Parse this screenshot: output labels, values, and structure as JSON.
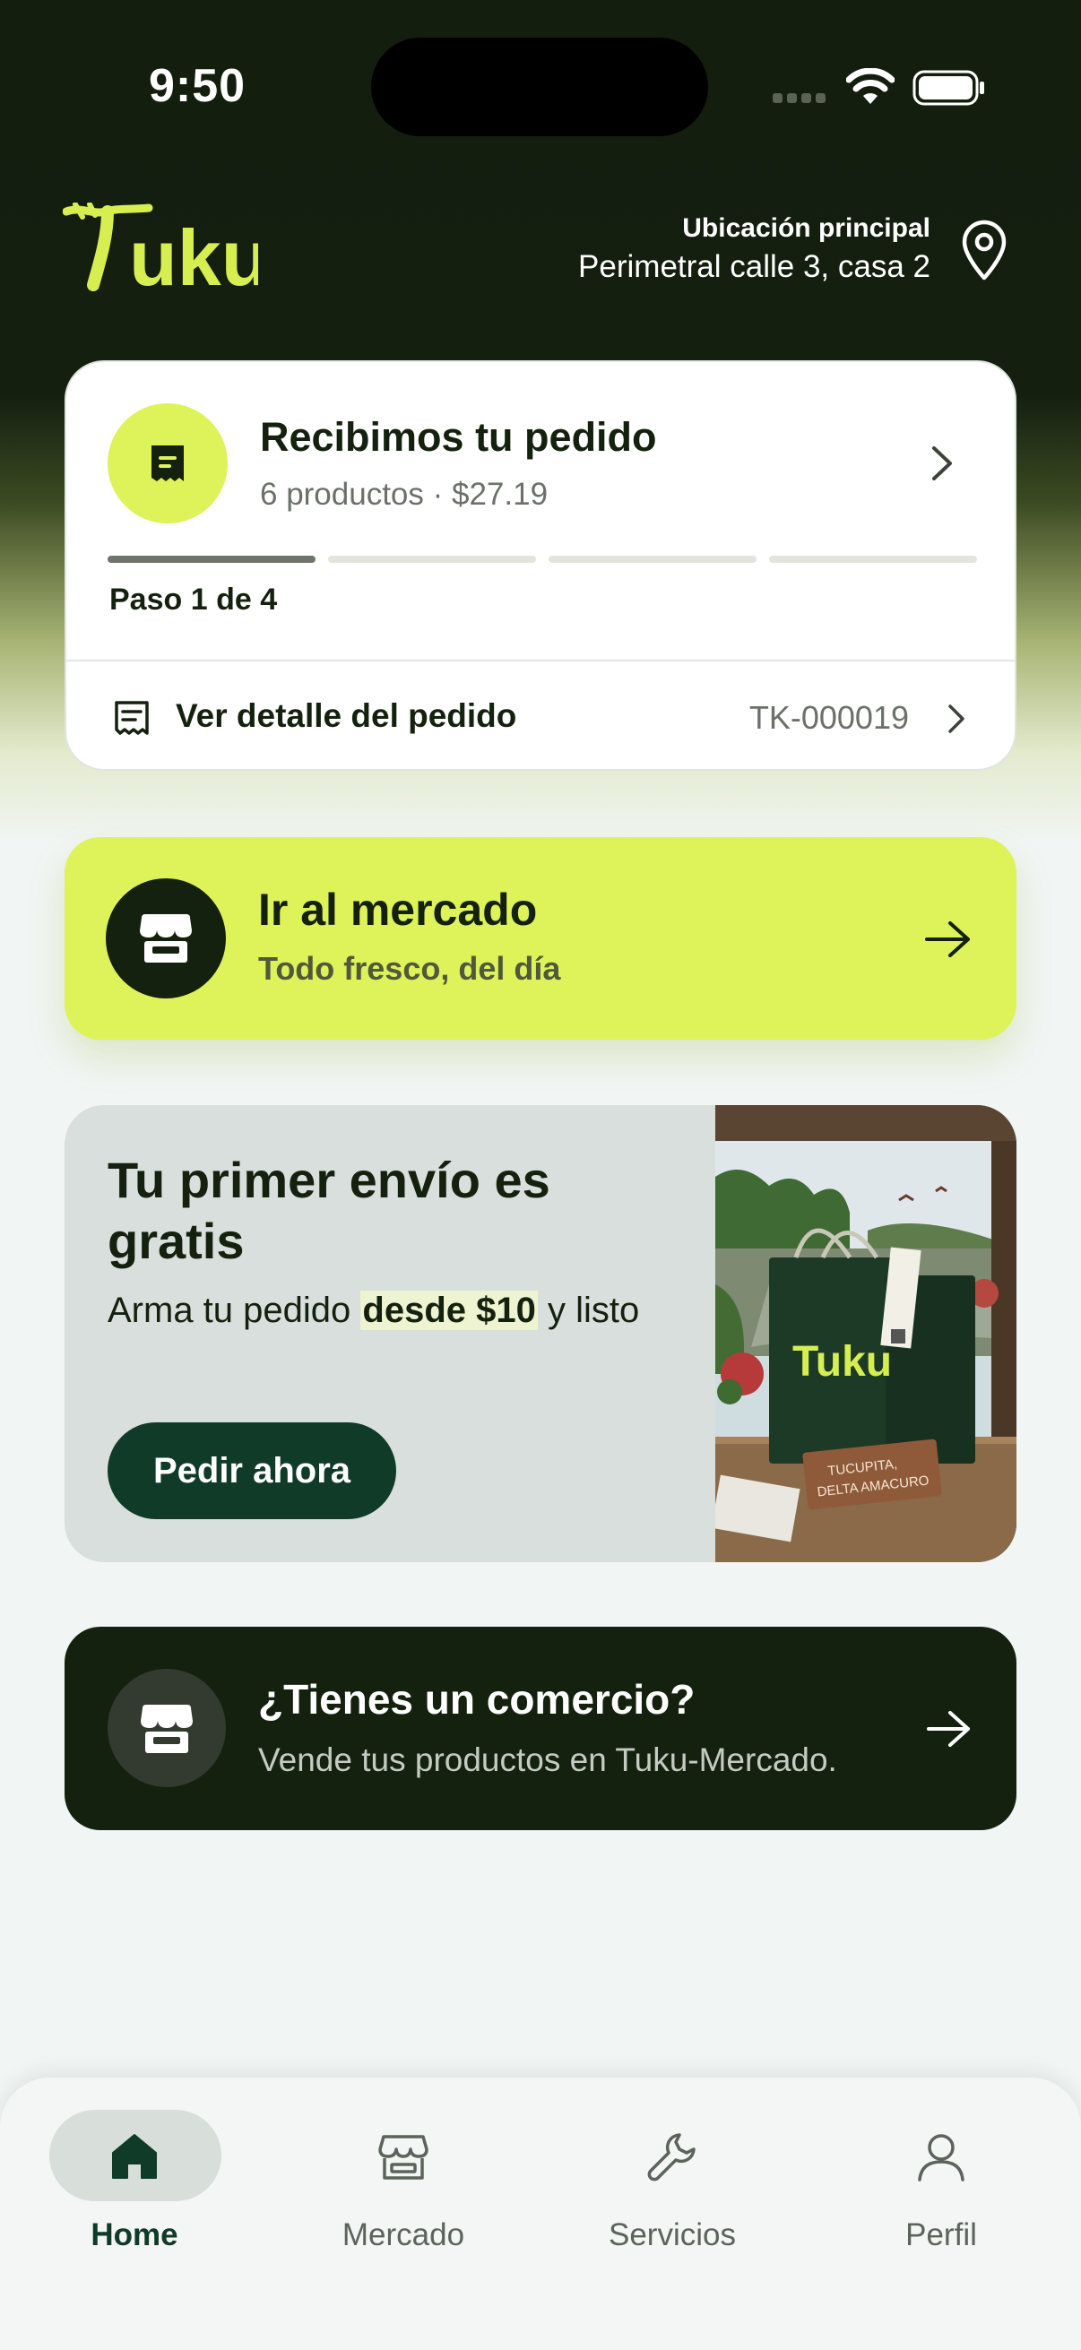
{
  "status_bar": {
    "time": "9:50",
    "icons": [
      "signal-icon",
      "wifi-icon",
      "battery-icon"
    ]
  },
  "header": {
    "logo_text": "Tuku",
    "location_label": "Ubicación principal",
    "location_address": "Perimetral calle 3, casa 2",
    "location_icon": "map-pin-icon"
  },
  "order": {
    "title": "Recibimos tu pedido",
    "meta": "6 productos · $27.19",
    "step_text": "Paso 1 de 4",
    "current_step": 1,
    "total_steps": 4,
    "detail_label": "Ver detalle del pedido",
    "order_code": "TK-000019"
  },
  "market": {
    "title": "Ir al mercado",
    "subtitle": "Todo fresco, del día"
  },
  "promo": {
    "title": "Tu primer envío es gratis",
    "desc_before": "Arma tu pedido ",
    "desc_highlight": "desde $10",
    "desc_after": " y listo",
    "button_label": "Pedir ahora",
    "image_bag_text": "Tuku",
    "image_sign_text_1": "TUCUPITA,",
    "image_sign_text_2": "DELTA AMACURO"
  },
  "merchant": {
    "title": "¿Tienes un comercio?",
    "subtitle": "Vende tus productos en Tuku-Mercado."
  },
  "nav": {
    "items": [
      {
        "label": "Home",
        "icon": "home-icon",
        "active": true
      },
      {
        "label": "Mercado",
        "icon": "store-icon",
        "active": false
      },
      {
        "label": "Servicios",
        "icon": "wrench-icon",
        "active": false
      },
      {
        "label": "Perfil",
        "icon": "user-icon",
        "active": false
      }
    ]
  },
  "colors": {
    "dark": "#15210f",
    "lime": "#def25a",
    "deep_green": "#0f3b28",
    "background": "#f1f5f4"
  }
}
